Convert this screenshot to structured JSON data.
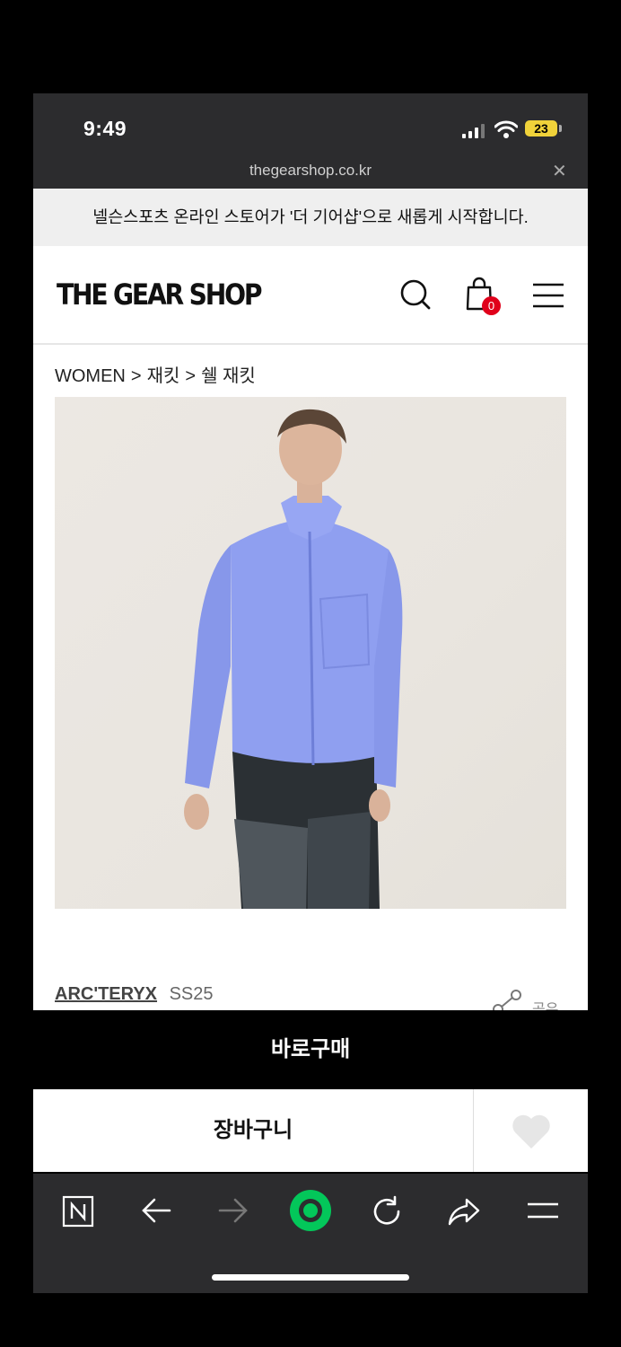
{
  "status_bar": {
    "time": "9:49",
    "battery": "23"
  },
  "browser": {
    "url": "thegearshop.co.kr",
    "close_icon": "close-icon"
  },
  "notice": {
    "text": "넬슨스포츠 온라인 스토어가 '더 기어샵'으로 새롭게 시작합니다."
  },
  "header": {
    "logo": "THE GEAR SHOP",
    "cart_count": "0",
    "icons": [
      "search-icon",
      "shopping-bag-icon",
      "hamburger-menu-icon"
    ]
  },
  "breadcrumb": {
    "items": [
      "WOMEN",
      ">",
      "재킷",
      ">",
      "쉘 재킷"
    ]
  },
  "product": {
    "brand": "ARC'TERYX",
    "season": "SS25",
    "share_label": "공유",
    "jacket_color": "#8f9ff0"
  },
  "actions": {
    "buy_now": "바로구매",
    "add_to_cart": "장바구니"
  },
  "toolbar": {
    "icons": [
      "naver-icon",
      "back-arrow-icon",
      "forward-arrow-icon",
      "green-dot-icon",
      "refresh-icon",
      "share-arrow-icon",
      "menu-icon"
    ],
    "accent": "#03c75a"
  }
}
